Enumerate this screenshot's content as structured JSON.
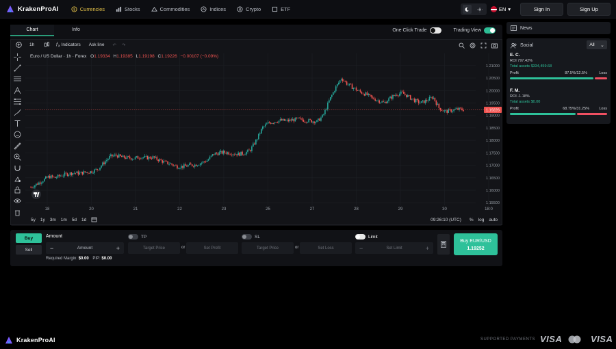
{
  "brand": {
    "name": "KrakenProAI"
  },
  "nav": {
    "items": [
      {
        "label": "Currencies",
        "icon": "currency-icon",
        "active": true
      },
      {
        "label": "Stocks",
        "icon": "bar-chart-icon"
      },
      {
        "label": "Commodities",
        "icon": "commodities-icon"
      },
      {
        "label": "Indices",
        "icon": "indices-icon"
      },
      {
        "label": "Crypto",
        "icon": "crypto-icon"
      },
      {
        "label": "ETF",
        "icon": "etf-icon"
      }
    ],
    "language": "EN",
    "signin_label": "Sign In",
    "signup_label": "Sign Up"
  },
  "panel": {
    "tabs": [
      "Chart",
      "Info"
    ],
    "one_click_label": "One Click Trade",
    "trading_view_label": "Trading View"
  },
  "chart_toolbar": {
    "interval": "1h",
    "indicators_label": "Indicators",
    "ask_line_label": "Ask line"
  },
  "chart_data": {
    "type": "candlestick",
    "title": "Euro / US Dollar · 1h · Forex",
    "ohlc": {
      "o_label": "O",
      "o": "1.19334",
      "h_label": "H",
      "h": "1.19385",
      "l_label": "L",
      "l": "1.19198",
      "c_label": "C",
      "c": "1.19226",
      "change": "−0.00107 (−0.09%)"
    },
    "current_price_tag": "1.19226",
    "current_price": 1.19226,
    "y_ticks": [
      "1.21000",
      "1.20500",
      "1.20000",
      "1.19500",
      "1.19000",
      "1.18500",
      "1.18000",
      "1.17500",
      "1.17000",
      "1.16500",
      "1.16000",
      "1.15500"
    ],
    "ylim": [
      1.1545,
      1.2127
    ],
    "x_ticks": [
      "18",
      "20",
      "21",
      "22",
      "23",
      "25",
      "27",
      "28",
      "29",
      "30",
      "18:0"
    ],
    "path": [
      1.1612,
      1.1625,
      1.164,
      1.1655,
      1.165,
      1.166,
      1.1665,
      1.167,
      1.1668,
      1.1672,
      1.1675,
      1.1685,
      1.171,
      1.1735,
      1.174,
      1.1732,
      1.173,
      1.1728,
      1.1734,
      1.173,
      1.1732,
      1.1722,
      1.1712,
      1.1705,
      1.1695,
      1.1695,
      1.17,
      1.1702,
      1.171,
      1.172,
      1.1745,
      1.175,
      1.1752,
      1.1748,
      1.1745,
      1.1748,
      1.176,
      1.18,
      1.185,
      1.187,
      1.1875,
      1.188,
      1.1878,
      1.1882,
      1.1885,
      1.188,
      1.1878,
      1.1875,
      1.19,
      1.196,
      1.201,
      1.205,
      1.2025,
      1.201,
      1.1995,
      1.1985,
      1.197,
      1.196,
      1.195,
      1.197,
      1.1985,
      1.199,
      1.1975,
      1.196,
      1.195,
      1.196,
      1.1975,
      1.193,
      1.1915,
      1.192,
      1.1925,
      1.1923
    ]
  },
  "bottom": {
    "ranges": [
      "5y",
      "1y",
      "3m",
      "1m",
      "5d",
      "1d"
    ],
    "time": "09:26:10 (UTC)",
    "pct": "%",
    "log": "log",
    "auto": "auto"
  },
  "trade": {
    "buy_label": "Buy",
    "sell_label": "Sell",
    "amount_label": "Amount",
    "amount_placeholder": "Amount",
    "tp_label": "TP",
    "sl_label": "SL",
    "limit_label": "Limit",
    "target_price": "Target Price",
    "set_profit": "Set Profit",
    "set_loss": "Set Loss",
    "set_limit": "Set Limit",
    "or": "or",
    "required_margin_label": "Required Margin:",
    "required_margin": "$0.00",
    "pip_label": "PIP:",
    "pip": "$0.00",
    "buy_button_label": "Buy EUR/USD",
    "buy_button_price": "1.19252"
  },
  "sidebar": {
    "news_label": "News",
    "social_label": "Social",
    "filter": "All",
    "traders": [
      {
        "name": "E. C.",
        "roi": "ROI 797.42%",
        "assets": "Total assets $334,459.68",
        "profit_label": "Profit",
        "ratio": "87.5%/12.5%",
        "loss_label": "Loss",
        "profit_share": 0.875
      },
      {
        "name": "F. M.",
        "roi": "ROI -1.18%",
        "assets": "Total assets $0.00",
        "profit_label": "Profit",
        "ratio": "68.75%/31.25%",
        "loss_label": "Loss",
        "profit_share": 0.6875
      }
    ]
  },
  "footer": {
    "brand": "KrakenProAI",
    "supported_label": "SUPPORTED PAYMENTS",
    "payments": [
      "VISA",
      "VISA"
    ]
  },
  "colors": {
    "accent_green": "#2ec19a",
    "candle_up": "#26a69a",
    "candle_down": "#ef5350",
    "active_nav": "#e8c54a"
  }
}
